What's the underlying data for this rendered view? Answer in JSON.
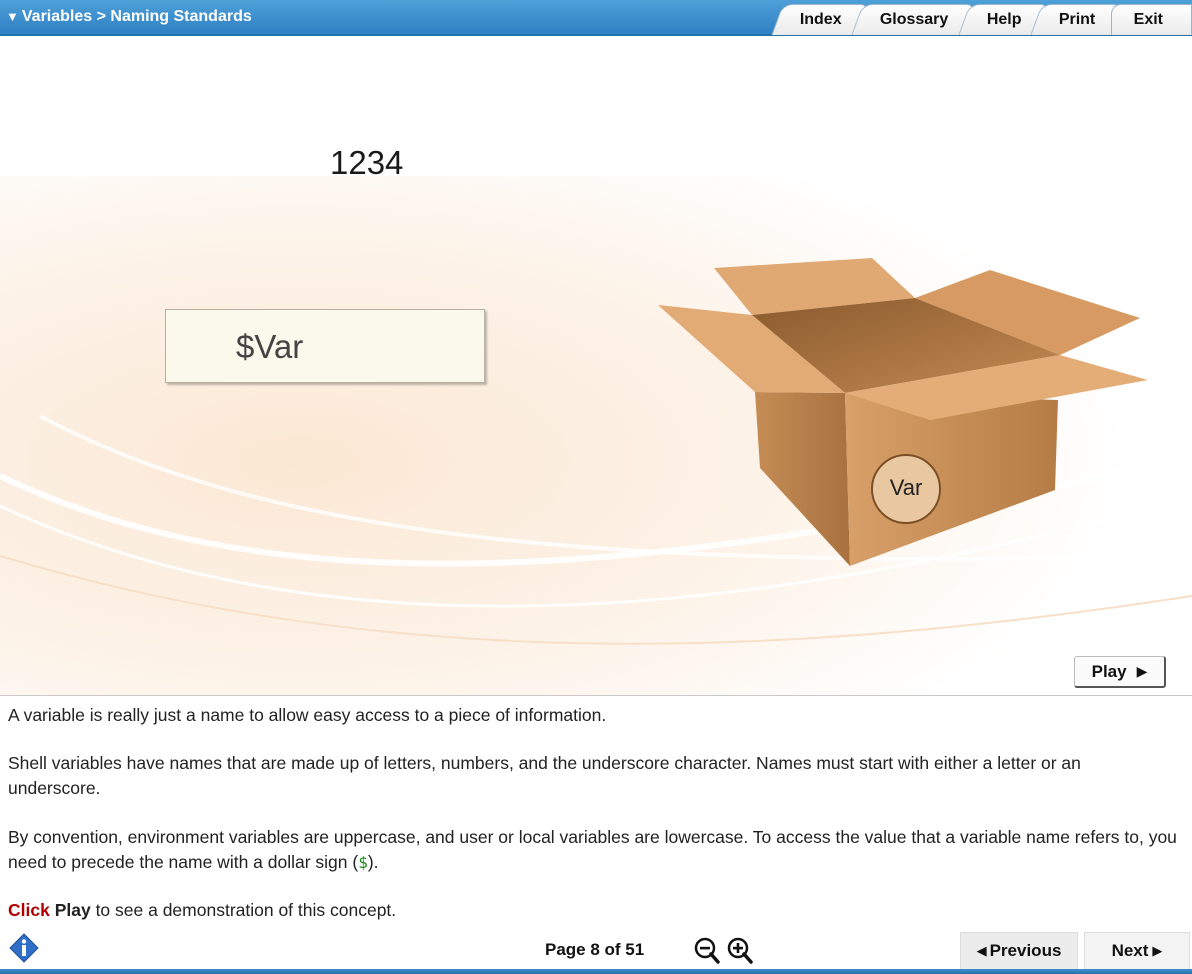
{
  "header": {
    "breadcrumb": "Variables > Naming Standards",
    "tabs": [
      "Index",
      "Glossary",
      "Help",
      "Print",
      "Exit"
    ]
  },
  "stage": {
    "number_text": "1234",
    "variable_box_text": "$Var",
    "box_label": "Var",
    "play_label": "Play"
  },
  "content": {
    "p1": "A variable is really just a name to allow easy access to a piece of information.",
    "p2": "Shell variables have names that are made up of letters, numbers, and the underscore character. Names must start with either a letter or an underscore.",
    "p3_before": "By convention, environment variables are uppercase, and user or local variables are lowercase. To access the value that a variable name refers to, you need to precede the name with a dollar sign (",
    "p3_code": "$",
    "p3_after": ").",
    "p4_click": "Click",
    "p4_play": "Play",
    "p4_rest": " to see a demonstration of this concept."
  },
  "footer": {
    "page_indicator": "Page 8 of 51",
    "previous_label": "Previous",
    "next_label": "Next"
  },
  "colors": {
    "header_blue": "#2f80c4",
    "box_light": "#dca06a",
    "box_dark": "#a8713f",
    "click_red": "#b00000",
    "code_green": "#1a8a1a"
  },
  "icons": {
    "breadcrumb": "triangle-down-icon",
    "play": "play-arrow-icon",
    "info": "info-diamond-icon",
    "zoom_out": "zoom-out-icon",
    "zoom_in": "zoom-in-icon",
    "previous": "triangle-left-icon",
    "next": "triangle-right-icon"
  }
}
